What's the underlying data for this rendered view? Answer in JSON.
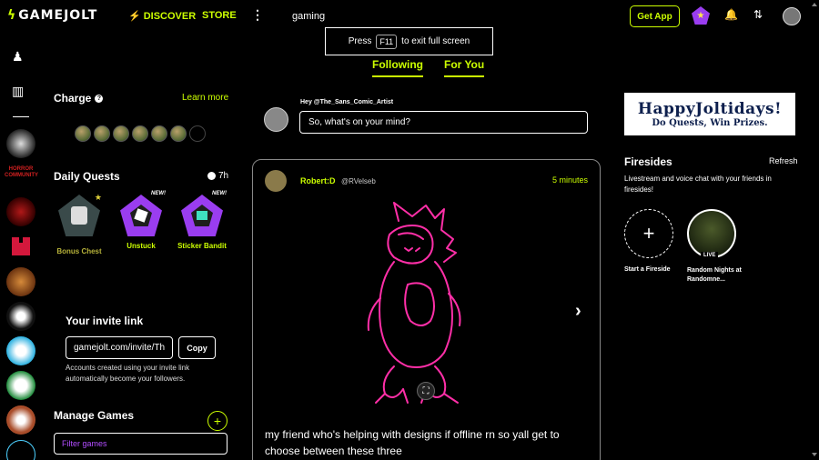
{
  "brand": {
    "name": "GAMEJOLT"
  },
  "nav": {
    "discover": "DISCOVER",
    "store": "STORE",
    "more": "⋮",
    "search_value": "gaming"
  },
  "header_actions": {
    "get_app": "Get App"
  },
  "fullscreen": {
    "press": "Press",
    "key": "F11",
    "message": "to exit full screen"
  },
  "tabs": [
    {
      "label": "Following"
    },
    {
      "label": "For You"
    }
  ],
  "charge": {
    "title": "Charge",
    "learn_more": "Learn more",
    "filled_orbs": 6,
    "total_orbs": 7
  },
  "daily_quests": {
    "title": "Daily Quests",
    "time_left": "7h",
    "items": [
      {
        "label": "Bonus Chest",
        "new": ""
      },
      {
        "label": "Unstuck",
        "new": "NEW!"
      },
      {
        "label": "Sticker Bandit",
        "new": "NEW!"
      }
    ]
  },
  "invite": {
    "title": "Your invite link",
    "link": "gamejolt.com/invite/Th",
    "copy": "Copy",
    "note": "Accounts created using your invite link automatically become your followers."
  },
  "manage_games": {
    "title": "Manage Games",
    "filter_placeholder": "Filter games"
  },
  "rail": {
    "horror_label": "HORROR COMMUNITY"
  },
  "compose": {
    "greeting": "Hey @The_Sans_Comic_Artist",
    "placeholder": "So, what's on your mind?"
  },
  "post": {
    "author": "Robert:D",
    "handle": "@RVelseb",
    "time": "5 minutes",
    "text": "my friend who's helping with designs if offline rn so yall get to choose between these three"
  },
  "banner": {
    "line1": "HappyJoltidays!",
    "line2": "Do Quests, Win Prizes."
  },
  "firesides": {
    "title": "Firesides",
    "refresh": "Refresh",
    "description": "Livestream and voice chat with your friends in firesides!",
    "start_label": "Start a Fireside",
    "live_badge": "LIVE",
    "live_label": "Random Nights at Randomne..."
  },
  "colors": {
    "accent": "#ccff00",
    "quest_purple": "#9a3df0",
    "drawing_pink": "#ff2fa8"
  }
}
